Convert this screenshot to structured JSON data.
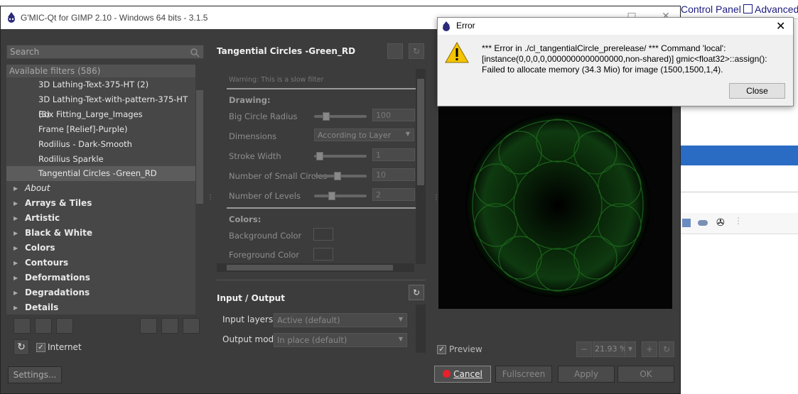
{
  "background": {
    "control_panel": "Control Panel",
    "advanced": "Advanced"
  },
  "window": {
    "title": "G'MIC-Qt for GIMP 2.10 - Windows 64 bits - 3.1.5"
  },
  "left": {
    "search_placeholder": "Search",
    "available_filters": "Available filters (586)",
    "filters": [
      "3D Lathing-Text-375-HT (2)",
      "3D Lathing-Text-with-pattern-375-HT (3)",
      "Box Fitting_Large_Images",
      "Frame [Relief]-Purple)",
      "Rodilius - Dark-Smooth",
      "Rodilius Sparkle",
      "Tangential Circles -Green_RD"
    ],
    "folders": [
      "About",
      "Arrays & Tiles",
      "Artistic",
      "Black & White",
      "Colors",
      "Contours",
      "Deformations",
      "Degradations",
      "Details"
    ],
    "internet_label": "Internet",
    "settings_label": "Settings..."
  },
  "middle": {
    "filter_title": "Tangential Circles -Green_RD",
    "warning": "Warning: This is a slow filter",
    "drawing_section": "Drawing:",
    "params": [
      {
        "label": "Big Circle Radius",
        "value": "100"
      },
      {
        "label": "Dimensions",
        "value": "According to Layer"
      },
      {
        "label": "Stroke Width",
        "value": "1"
      },
      {
        "label": "Number of Small Circles",
        "value": "10"
      },
      {
        "label": "Number of Levels",
        "value": "2"
      }
    ],
    "colors_section": "Colors:",
    "background_color": "Background Color",
    "foreground_color": "Foreground Color",
    "io_title": "Input / Output",
    "input_layers_label": "Input layers",
    "input_layers_value": "Active (default)",
    "output_mode_label": "Output mode",
    "output_mode_value": "In place (default)"
  },
  "preview": {
    "preview_label": "Preview",
    "zoom": "21.93 %"
  },
  "buttons": {
    "cancel": "Cancel",
    "fullscreen": "Fullscreen",
    "apply": "Apply",
    "ok": "OK"
  },
  "error": {
    "title": "Error",
    "message": "*** Error in ./cl_tangentialCircle_prerelease/ *** Command 'local': [instance(0,0,0,0,0000000000000000,non-shared)] gmic<float32>::assign(): Failed to allocate memory (34.3 Mio) for image (1500,1500,1,4).",
    "close": "Close"
  },
  "colors": {
    "accent_blue": "#2a6bc4",
    "panel": "#3c3c3c",
    "cancel_icon": "#e8202a"
  }
}
